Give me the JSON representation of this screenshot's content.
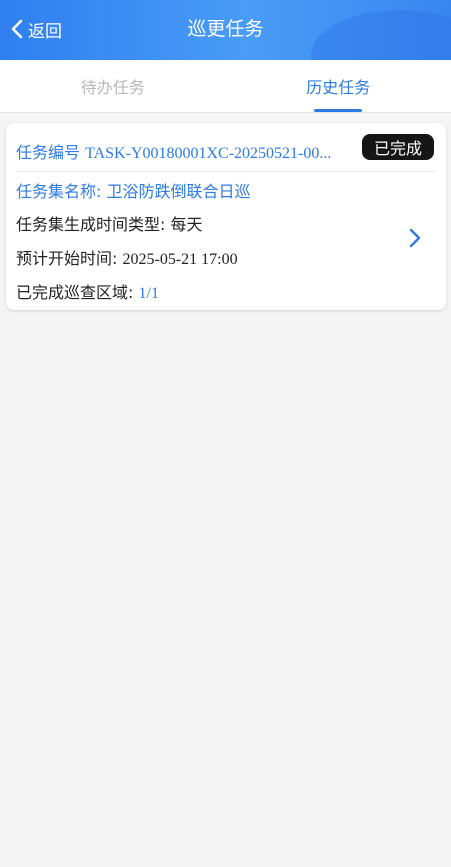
{
  "header": {
    "back_label": "返回",
    "title": "巡更任务"
  },
  "tabs": [
    {
      "label": "待办任务",
      "active": false
    },
    {
      "label": "历史任务",
      "active": true
    }
  ],
  "task": {
    "number_label": "任务编号",
    "number_value": "TASK-Y00180001XC-20250521-00...",
    "status": "已完成",
    "set_name_label": "任务集名称:",
    "set_name_value": "卫浴防跌倒联合日巡",
    "gen_type_label": "任务集生成时间类型:",
    "gen_type_value": "每天",
    "start_label": "预计开始时间:",
    "start_value": "2025-05-21 17:00",
    "area_label": "已完成巡查区域:",
    "area_value": "1/1"
  },
  "colors": {
    "accent": "#2d7be5",
    "header_blue": "#3a8cf3",
    "badge_bg": "#161616",
    "inactive_tab": "#b9b9b9"
  },
  "icons": {
    "back": "chevron-left-icon",
    "card_arrow": "chevron-right-icon"
  }
}
